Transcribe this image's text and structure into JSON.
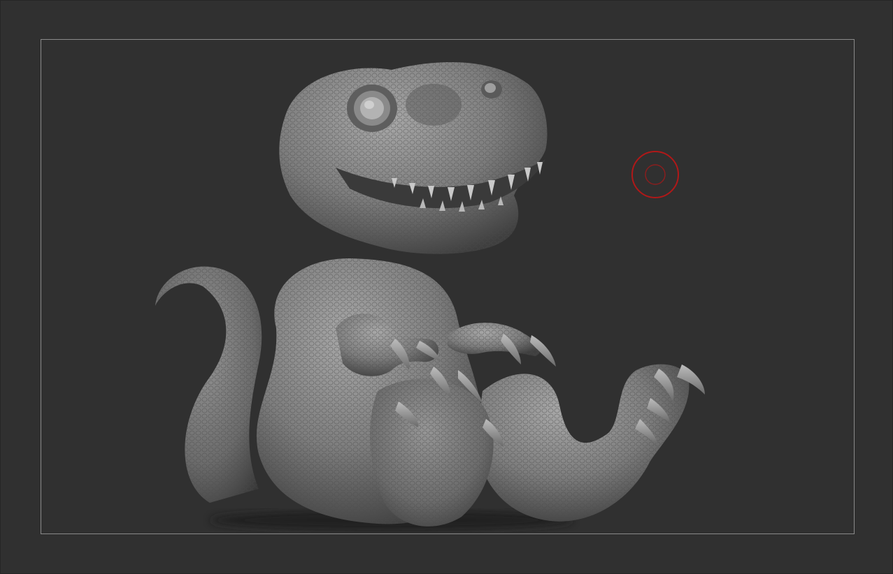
{
  "app": {
    "canvas_color": "#303030",
    "frame_color": "#8a8a8a"
  },
  "model": {
    "subject": "baby-trex-sculpt",
    "material_color": "#8c8c8c"
  },
  "brush": {
    "icon": "brush-cursor-icon",
    "color": "#b01818"
  }
}
